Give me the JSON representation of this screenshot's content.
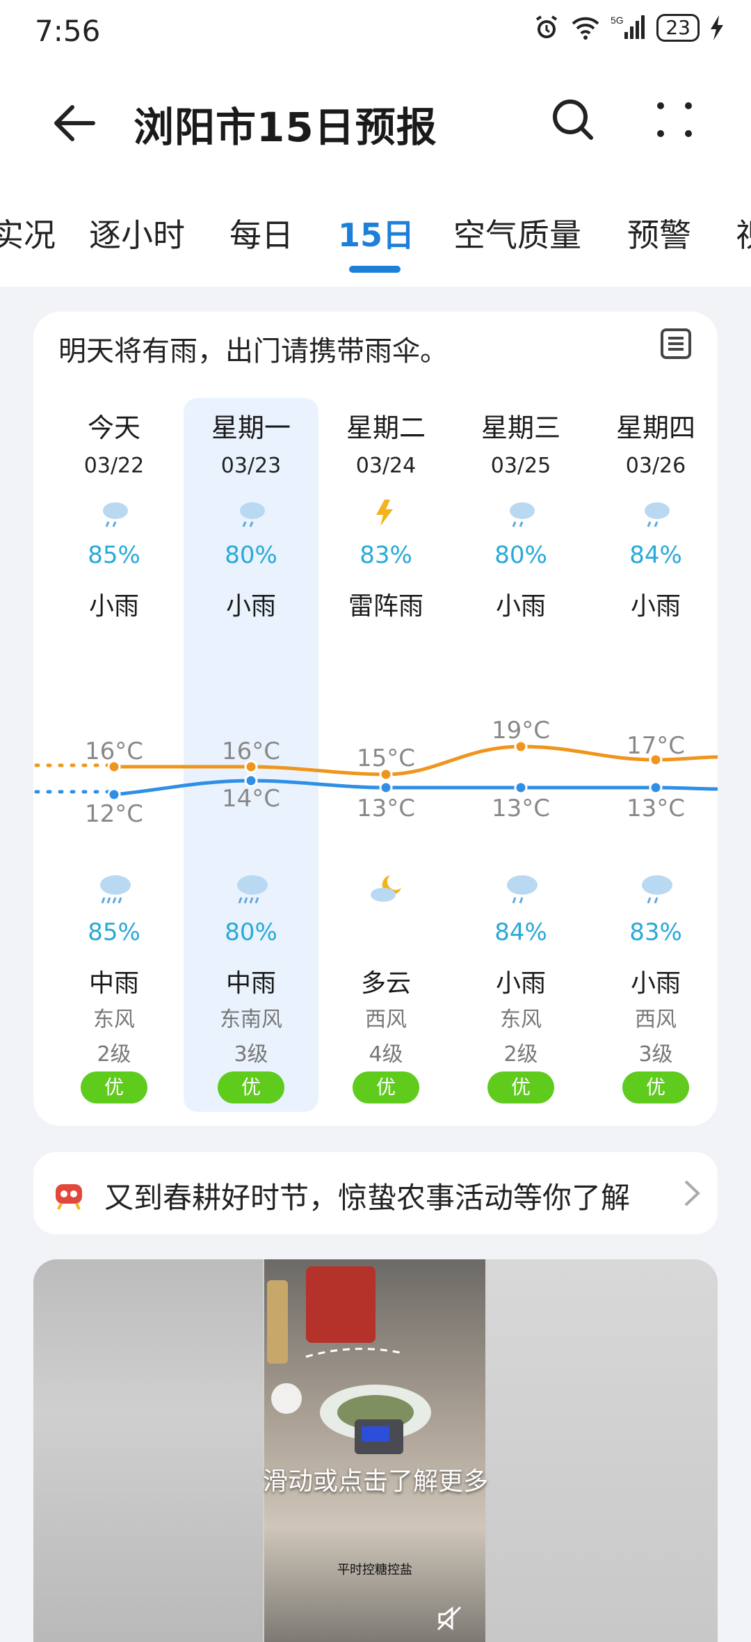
{
  "status": {
    "time": "7:56",
    "battery": "23"
  },
  "header": {
    "title": "浏阳市15日预报"
  },
  "tabs": [
    "实况",
    "逐小时",
    "每日",
    "15日",
    "空气质量",
    "预警",
    "视"
  ],
  "active_tab": "15日",
  "notice": "明天将有雨，出门请携带雨伞。",
  "days": [
    {
      "weekday": "今天",
      "date": "03/22",
      "day_prob": "85%",
      "day_weather": "小雨",
      "high": "16°C",
      "low": "12°C",
      "night_prob": "85%",
      "night_weather": "中雨",
      "wind_dir": "东风",
      "wind_level": "2级",
      "aqi": "优"
    },
    {
      "weekday": "星期一",
      "date": "03/23",
      "day_prob": "80%",
      "day_weather": "小雨",
      "high": "16°C",
      "low": "14°C",
      "night_prob": "80%",
      "night_weather": "中雨",
      "wind_dir": "东南风",
      "wind_level": "3级",
      "aqi": "优"
    },
    {
      "weekday": "星期二",
      "date": "03/24",
      "day_prob": "83%",
      "day_weather": "雷阵雨",
      "high": "15°C",
      "low": "13°C",
      "night_prob": "",
      "night_weather": "多云",
      "wind_dir": "西风",
      "wind_level": "4级",
      "aqi": "优"
    },
    {
      "weekday": "星期三",
      "date": "03/25",
      "day_prob": "80%",
      "day_weather": "小雨",
      "high": "19°C",
      "low": "13°C",
      "night_prob": "84%",
      "night_weather": "小雨",
      "wind_dir": "东风",
      "wind_level": "2级",
      "aqi": "优"
    },
    {
      "weekday": "星期四",
      "date": "03/26",
      "day_prob": "84%",
      "day_weather": "小雨",
      "high": "17°C",
      "low": "13°C",
      "night_prob": "83%",
      "night_weather": "小雨",
      "wind_dir": "西风",
      "wind_level": "3级",
      "aqi": "优"
    }
  ],
  "banner": {
    "text": "又到春耕好时节，惊蛰农事活动等你了解"
  },
  "video": {
    "overlay": "滑动或点击了解更多",
    "caption": "平时控糖控盐"
  },
  "colors": {
    "accent": "#1e7fd8",
    "high_line": "#f0951c",
    "low_line": "#2f8fe6",
    "aqi_good": "#5fcb1d",
    "prob": "#28a9d8"
  }
}
